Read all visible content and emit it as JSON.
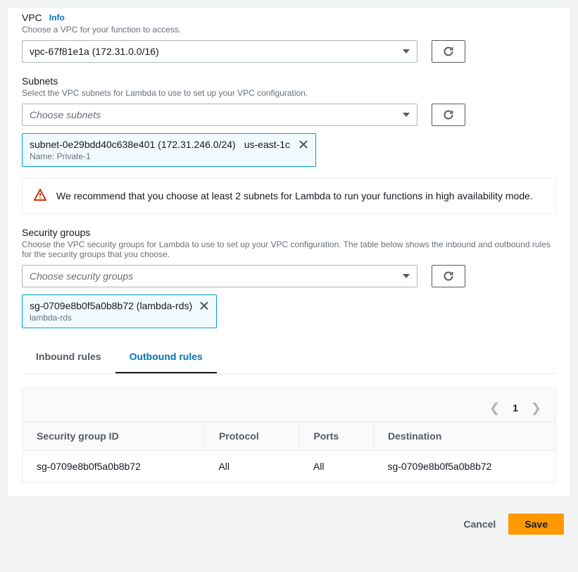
{
  "vpc": {
    "title": "VPC",
    "info": "Info",
    "help": "Choose a VPC for your function to access.",
    "selected": "vpc-67f81e1a (172.31.0.0/16)"
  },
  "subnets": {
    "title": "Subnets",
    "help": "Select the VPC subnets for Lambda to use to set up your VPC configuration.",
    "placeholder": "Choose subnets",
    "tag_id": "subnet-0e29bdd40c638e401 (172.31.246.0/24)",
    "tag_az": "us-east-1c",
    "tag_name": "Name: Private-1"
  },
  "alert": {
    "text": "We recommend that you choose at least 2 subnets for Lambda to run your functions in high availability mode."
  },
  "sg": {
    "title": "Security groups",
    "help": "Choose the VPC security groups for Lambda to use to set up your VPC configuration. The table below shows the inbound and outbound rules for the security groups that you choose.",
    "placeholder": "Choose security groups",
    "tag_id": "sg-0709e8b0f5a0b8b72 (lambda-rds)",
    "tag_name": "lambda-rds"
  },
  "tabs": {
    "inbound": "Inbound rules",
    "outbound": "Outbound rules"
  },
  "pagination": {
    "page": "1"
  },
  "table": {
    "headers": {
      "sgid": "Security group ID",
      "proto": "Protocol",
      "ports": "Ports",
      "dest": "Destination"
    },
    "row": {
      "sgid": "sg-0709e8b0f5a0b8b72",
      "proto": "All",
      "ports": "All",
      "dest": "sg-0709e8b0f5a0b8b72"
    }
  },
  "footer": {
    "cancel": "Cancel",
    "save": "Save"
  }
}
